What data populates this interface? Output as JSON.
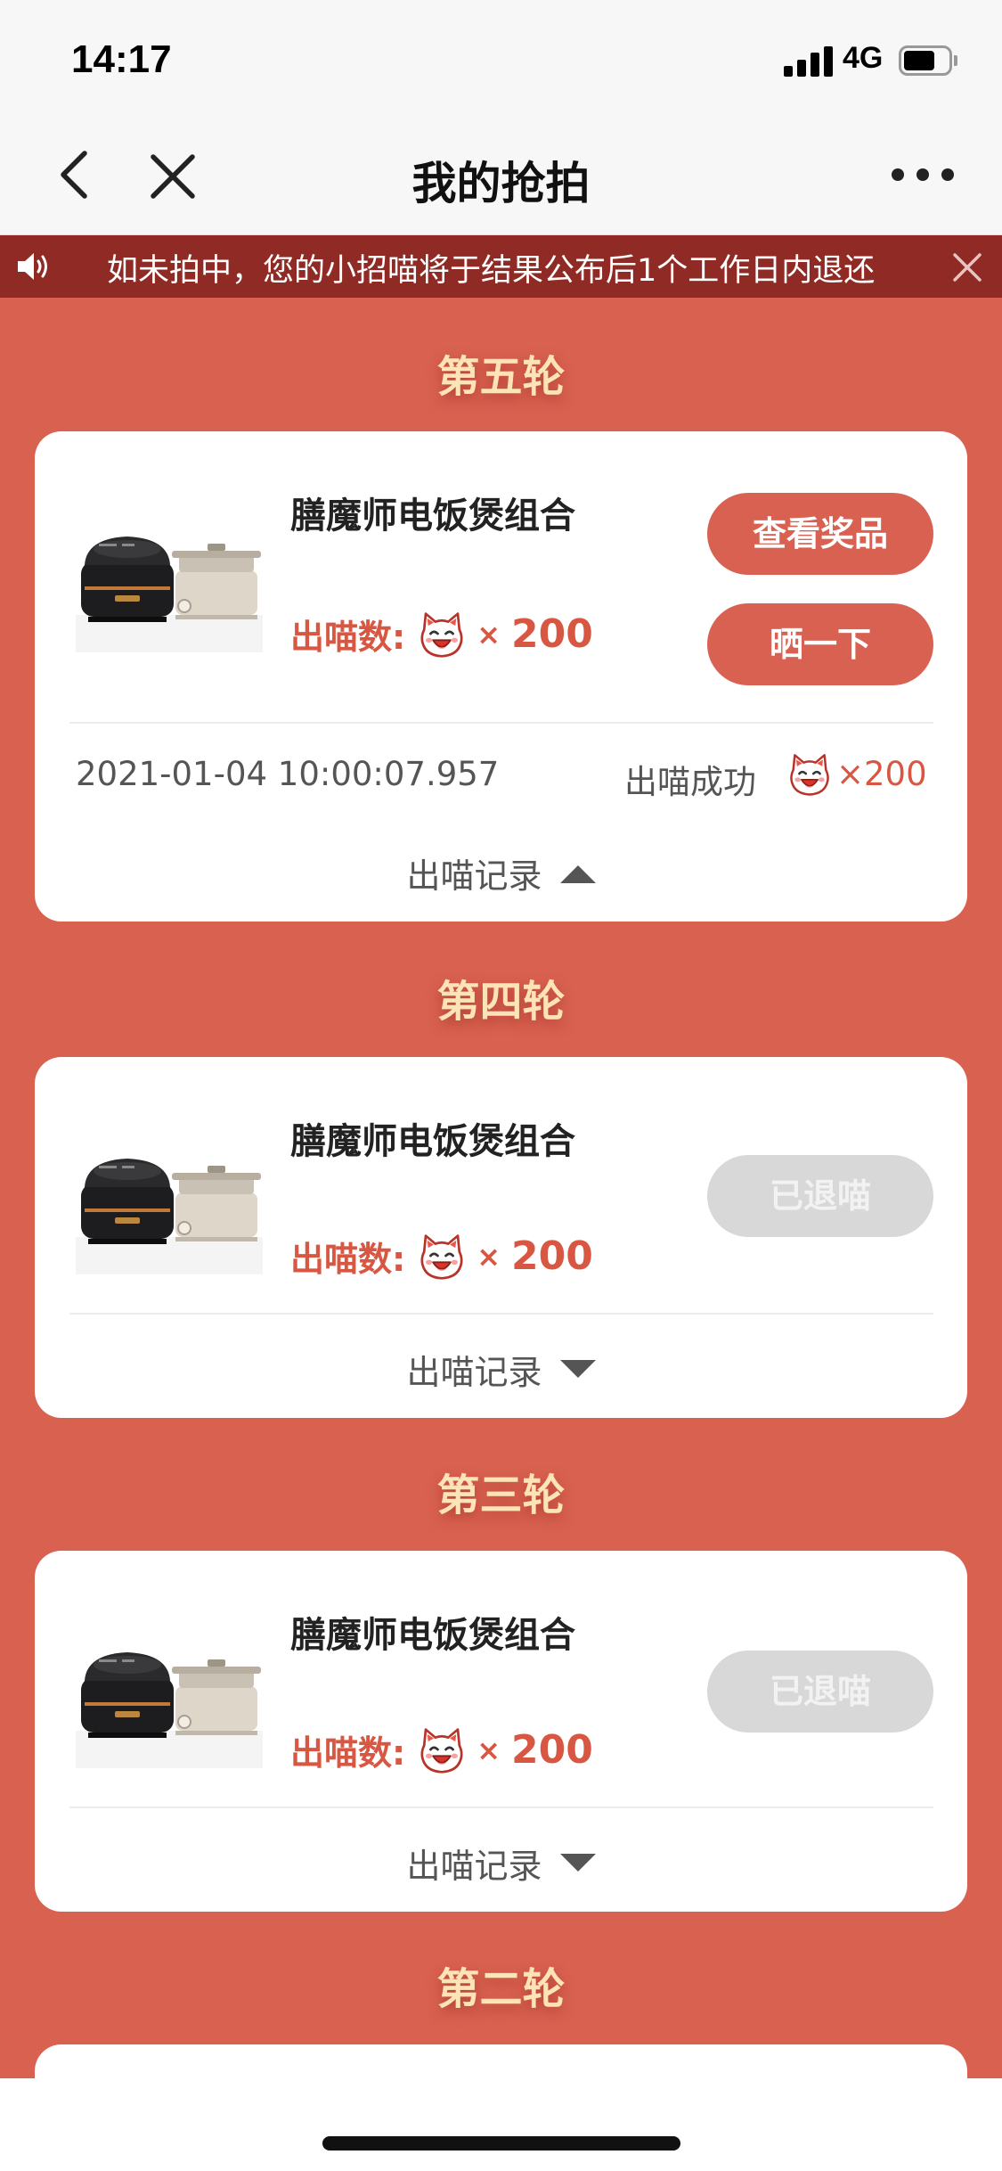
{
  "status_bar": {
    "time": "14:17",
    "network": "4G",
    "battery_level": 0.7
  },
  "nav": {
    "title": "我的抢拍",
    "back_icon": "chevron-left-icon",
    "close_icon": "close-icon",
    "more_icon": "more-dots-icon"
  },
  "notice": {
    "text": "如未拍中，您的小招喵将于结果公布后1个工作日内退还",
    "icon": "speaker-icon"
  },
  "rounds": [
    {
      "title": "第五轮",
      "product_name": "膳魔师电饭煲组合",
      "bid_label": "出喵数:",
      "bid_times": "×",
      "bid_amount": "200",
      "buttons": [
        "查看奖品",
        "晒一下"
      ],
      "records_label": "出喵记录",
      "records_expanded": true,
      "records": [
        {
          "time": "2021-01-04 10:00:07.957",
          "status": "出喵成功",
          "amount": "×200"
        }
      ]
    },
    {
      "title": "第四轮",
      "product_name": "膳魔师电饭煲组合",
      "bid_label": "出喵数:",
      "bid_times": "×",
      "bid_amount": "200",
      "buttons": [
        "已退喵"
      ],
      "records_label": "出喵记录",
      "records_expanded": false
    },
    {
      "title": "第三轮",
      "product_name": "膳魔师电饭煲组合",
      "bid_label": "出喵数:",
      "bid_times": "×",
      "bid_amount": "200",
      "buttons": [
        "已退喵"
      ],
      "records_label": "出喵记录",
      "records_expanded": false
    },
    {
      "title": "第二轮"
    }
  ],
  "colors": {
    "page_background": "#d96150",
    "notice_background": "#8f2a24",
    "accent_red": "#d85743",
    "button_red": "#d86152",
    "button_disabled": "#d8d8d8",
    "round_title": "#fde4b8"
  }
}
